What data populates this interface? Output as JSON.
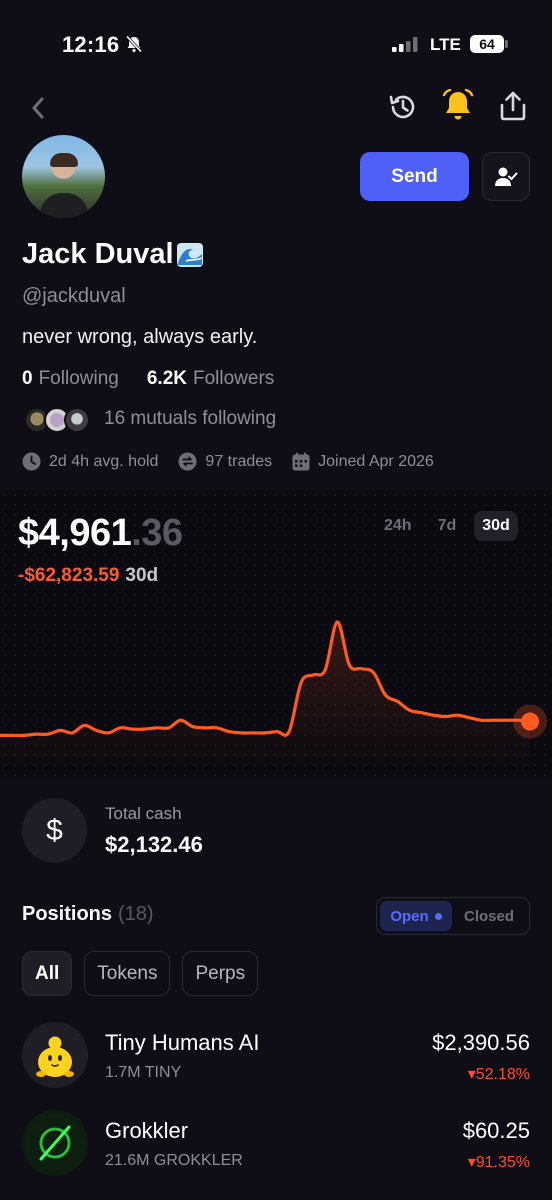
{
  "status_bar": {
    "time": "12:16",
    "network": "LTE",
    "battery": "64"
  },
  "profile": {
    "name": "Jack Duval",
    "handle": "@jackduval",
    "bio": "never wrong, always early.",
    "following_count": "0",
    "following_label": "Following",
    "followers_count": "6.2K",
    "followers_label": "Followers",
    "mutuals_text": "16 mutuals following",
    "avg_hold": "2d 4h avg. hold",
    "trades": "97 trades",
    "joined": "Joined Apr 2026",
    "send_label": "Send"
  },
  "portfolio": {
    "balance_main": "$4,961",
    "balance_cents": ".36",
    "change_value": "-$62,823.59",
    "change_period": "30d",
    "ranges": [
      "24h",
      "7d",
      "30d"
    ],
    "active_range": "30d",
    "accent_color": "#ff5a1f",
    "negative_color": "#ff4a2b"
  },
  "cash": {
    "icon": "$",
    "label": "Total cash",
    "value": "$2,132.46"
  },
  "positions": {
    "title": "Positions",
    "count": "(18)",
    "toggle_open": "Open",
    "toggle_closed": "Closed",
    "filters": [
      "All",
      "Tokens",
      "Perps"
    ],
    "items": [
      {
        "name": "Tiny Humans AI",
        "amount": "1.7M TINY",
        "value": "$2,390.56",
        "change": "52.18%",
        "icon": "tiny-humans-token-icon"
      },
      {
        "name": "Grokkler",
        "amount": "21.6M GROKKLER",
        "value": "$60.25",
        "change": "91.35%",
        "icon": "grokkler-token-icon"
      }
    ]
  },
  "chart_data": {
    "type": "line",
    "series": [
      {
        "values": [
          0.1,
          0.1,
          0.1,
          0.11,
          0.11,
          0.14,
          0.12,
          0.18,
          0.14,
          0.12,
          0.16,
          0.15,
          0.15,
          0.16,
          0.16,
          0.22,
          0.17,
          0.16,
          0.16,
          0.13,
          0.12,
          0.12,
          0.12,
          0.13,
          0.13,
          0.52,
          0.58,
          0.62,
          1.0,
          0.66,
          0.63,
          0.6,
          0.42,
          0.37,
          0.3,
          0.28,
          0.26,
          0.25,
          0.26,
          0.24,
          0.22,
          0.22,
          0.22,
          0.22,
          0.21
        ]
      }
    ]
  }
}
